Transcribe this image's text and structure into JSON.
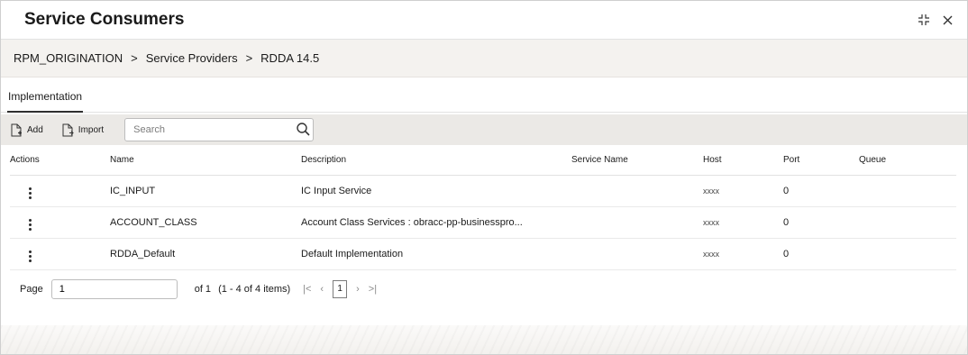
{
  "window": {
    "title": "Service Consumers"
  },
  "breadcrumb": [
    "RPM_ORIGINATION",
    "Service Providers",
    "RDDA 14.5"
  ],
  "breadcrumb_separator": ">",
  "tabs": [
    {
      "label": "Implementation",
      "active": true
    }
  ],
  "toolbar": {
    "add_label": "Add",
    "import_label": "Import",
    "search_placeholder": "Search"
  },
  "table": {
    "columns": [
      "Actions",
      "Name",
      "Description",
      "Service Name",
      "Host",
      "Port",
      "Queue"
    ],
    "rows": [
      {
        "name": "IC_INPUT",
        "description": "IC Input Service",
        "service_name": "",
        "host": "xxxx",
        "port": "0",
        "queue": ""
      },
      {
        "name": "ACCOUNT_CLASS",
        "description": "Account Class Services : obracc-pp-businesspro...",
        "service_name": "",
        "host": "xxxx",
        "port": "0",
        "queue": ""
      },
      {
        "name": "RDDA_Default",
        "description": "Default Implementation",
        "service_name": "",
        "host": "xxxx",
        "port": "0",
        "queue": ""
      }
    ]
  },
  "pagination": {
    "page_label": "Page",
    "page_value": "1",
    "of_text": "of 1",
    "range_text": "(1 - 4 of 4 items)",
    "current_page": "1",
    "first_glyph": "|<",
    "prev_glyph": "‹",
    "next_glyph": "›",
    "last_glyph": ">|"
  },
  "colors": {
    "breadcrumb_bg": "#f4f2ef",
    "toolbar_bg": "#ebe9e6",
    "tab_underline": "#2f2f2f"
  },
  "icons": {
    "collapse": "collapse-icon",
    "close": "close-icon",
    "add": "add-document-icon",
    "import": "import-document-icon",
    "search": "search-icon",
    "row_actions": "kebab-menu-icon"
  }
}
